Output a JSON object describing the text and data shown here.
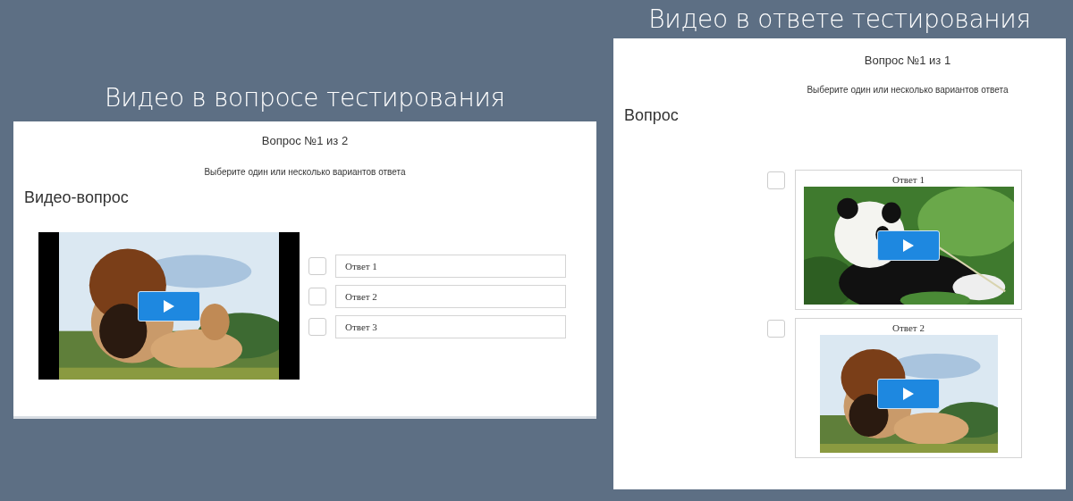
{
  "panels": [
    {
      "caption": "Видео в вопросе тестирования",
      "kind": "question-video",
      "counter": "Вопрос №1 из 2",
      "instruction": "Выберите один или несколько вариантов ответа",
      "question": "Видео-вопрос",
      "answers": [
        {
          "label": "Ответ 1",
          "checked": false
        },
        {
          "label": "Ответ 2",
          "checked": false
        },
        {
          "label": "Ответ 3",
          "checked": false
        }
      ]
    },
    {
      "caption": "Видео в ответе тестирования",
      "kind": "answer-video",
      "counter": "Вопрос №1 из 1",
      "instruction": "Выберите один или несколько вариантов ответа",
      "question": "Вопрос",
      "answers": [
        {
          "label": "Ответ 1",
          "checked": false
        },
        {
          "label": "Ответ 2",
          "checked": false
        }
      ]
    }
  ]
}
